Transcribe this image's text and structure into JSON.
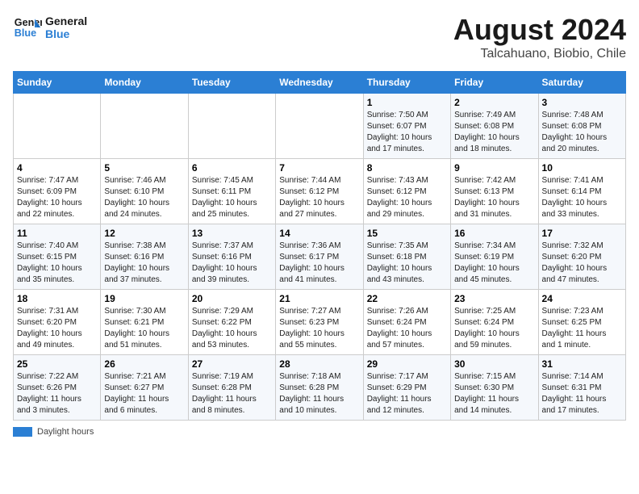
{
  "header": {
    "logo_line1": "General",
    "logo_line2": "Blue",
    "title": "August 2024",
    "subtitle": "Talcahuano, Biobio, Chile"
  },
  "weekdays": [
    "Sunday",
    "Monday",
    "Tuesday",
    "Wednesday",
    "Thursday",
    "Friday",
    "Saturday"
  ],
  "weeks": [
    [
      {
        "day": "",
        "info": ""
      },
      {
        "day": "",
        "info": ""
      },
      {
        "day": "",
        "info": ""
      },
      {
        "day": "",
        "info": ""
      },
      {
        "day": "1",
        "info": "Sunrise: 7:50 AM\nSunset: 6:07 PM\nDaylight: 10 hours\nand 17 minutes."
      },
      {
        "day": "2",
        "info": "Sunrise: 7:49 AM\nSunset: 6:08 PM\nDaylight: 10 hours\nand 18 minutes."
      },
      {
        "day": "3",
        "info": "Sunrise: 7:48 AM\nSunset: 6:08 PM\nDaylight: 10 hours\nand 20 minutes."
      }
    ],
    [
      {
        "day": "4",
        "info": "Sunrise: 7:47 AM\nSunset: 6:09 PM\nDaylight: 10 hours\nand 22 minutes."
      },
      {
        "day": "5",
        "info": "Sunrise: 7:46 AM\nSunset: 6:10 PM\nDaylight: 10 hours\nand 24 minutes."
      },
      {
        "day": "6",
        "info": "Sunrise: 7:45 AM\nSunset: 6:11 PM\nDaylight: 10 hours\nand 25 minutes."
      },
      {
        "day": "7",
        "info": "Sunrise: 7:44 AM\nSunset: 6:12 PM\nDaylight: 10 hours\nand 27 minutes."
      },
      {
        "day": "8",
        "info": "Sunrise: 7:43 AM\nSunset: 6:12 PM\nDaylight: 10 hours\nand 29 minutes."
      },
      {
        "day": "9",
        "info": "Sunrise: 7:42 AM\nSunset: 6:13 PM\nDaylight: 10 hours\nand 31 minutes."
      },
      {
        "day": "10",
        "info": "Sunrise: 7:41 AM\nSunset: 6:14 PM\nDaylight: 10 hours\nand 33 minutes."
      }
    ],
    [
      {
        "day": "11",
        "info": "Sunrise: 7:40 AM\nSunset: 6:15 PM\nDaylight: 10 hours\nand 35 minutes."
      },
      {
        "day": "12",
        "info": "Sunrise: 7:38 AM\nSunset: 6:16 PM\nDaylight: 10 hours\nand 37 minutes."
      },
      {
        "day": "13",
        "info": "Sunrise: 7:37 AM\nSunset: 6:16 PM\nDaylight: 10 hours\nand 39 minutes."
      },
      {
        "day": "14",
        "info": "Sunrise: 7:36 AM\nSunset: 6:17 PM\nDaylight: 10 hours\nand 41 minutes."
      },
      {
        "day": "15",
        "info": "Sunrise: 7:35 AM\nSunset: 6:18 PM\nDaylight: 10 hours\nand 43 minutes."
      },
      {
        "day": "16",
        "info": "Sunrise: 7:34 AM\nSunset: 6:19 PM\nDaylight: 10 hours\nand 45 minutes."
      },
      {
        "day": "17",
        "info": "Sunrise: 7:32 AM\nSunset: 6:20 PM\nDaylight: 10 hours\nand 47 minutes."
      }
    ],
    [
      {
        "day": "18",
        "info": "Sunrise: 7:31 AM\nSunset: 6:20 PM\nDaylight: 10 hours\nand 49 minutes."
      },
      {
        "day": "19",
        "info": "Sunrise: 7:30 AM\nSunset: 6:21 PM\nDaylight: 10 hours\nand 51 minutes."
      },
      {
        "day": "20",
        "info": "Sunrise: 7:29 AM\nSunset: 6:22 PM\nDaylight: 10 hours\nand 53 minutes."
      },
      {
        "day": "21",
        "info": "Sunrise: 7:27 AM\nSunset: 6:23 PM\nDaylight: 10 hours\nand 55 minutes."
      },
      {
        "day": "22",
        "info": "Sunrise: 7:26 AM\nSunset: 6:24 PM\nDaylight: 10 hours\nand 57 minutes."
      },
      {
        "day": "23",
        "info": "Sunrise: 7:25 AM\nSunset: 6:24 PM\nDaylight: 10 hours\nand 59 minutes."
      },
      {
        "day": "24",
        "info": "Sunrise: 7:23 AM\nSunset: 6:25 PM\nDaylight: 11 hours\nand 1 minute."
      }
    ],
    [
      {
        "day": "25",
        "info": "Sunrise: 7:22 AM\nSunset: 6:26 PM\nDaylight: 11 hours\nand 3 minutes."
      },
      {
        "day": "26",
        "info": "Sunrise: 7:21 AM\nSunset: 6:27 PM\nDaylight: 11 hours\nand 6 minutes."
      },
      {
        "day": "27",
        "info": "Sunrise: 7:19 AM\nSunset: 6:28 PM\nDaylight: 11 hours\nand 8 minutes."
      },
      {
        "day": "28",
        "info": "Sunrise: 7:18 AM\nSunset: 6:28 PM\nDaylight: 11 hours\nand 10 minutes."
      },
      {
        "day": "29",
        "info": "Sunrise: 7:17 AM\nSunset: 6:29 PM\nDaylight: 11 hours\nand 12 minutes."
      },
      {
        "day": "30",
        "info": "Sunrise: 7:15 AM\nSunset: 6:30 PM\nDaylight: 11 hours\nand 14 minutes."
      },
      {
        "day": "31",
        "info": "Sunrise: 7:14 AM\nSunset: 6:31 PM\nDaylight: 11 hours\nand 17 minutes."
      }
    ]
  ],
  "legend": {
    "color_label": "Daylight hours"
  }
}
